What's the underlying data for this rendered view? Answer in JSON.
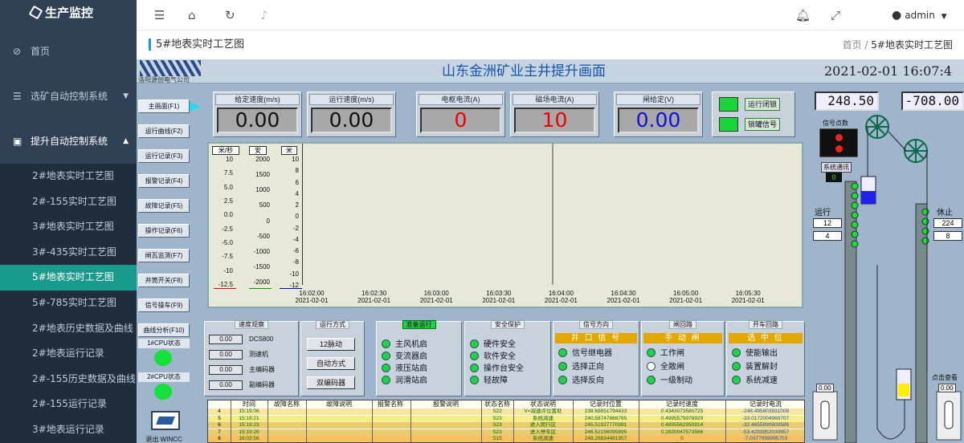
{
  "app": {
    "title": "生产监控"
  },
  "sidebar": {
    "items": [
      {
        "label": "首页"
      },
      {
        "label": "选矿自动控制系统"
      },
      {
        "label": "提升自动控制系统"
      }
    ],
    "subitems": [
      {
        "label": "2#地表实时工艺图"
      },
      {
        "label": "2#-155实时工艺图"
      },
      {
        "label": "3#地表实时工艺图"
      },
      {
        "label": "3#-435实时工艺图"
      },
      {
        "label": "5#地表实时工艺图"
      },
      {
        "label": "5#-785实时工艺图"
      },
      {
        "label": "2#地表历史数据及曲线"
      },
      {
        "label": "2#地表运行记录"
      },
      {
        "label": "2#-155历史数据及曲线"
      },
      {
        "label": "2#-155运行记录"
      },
      {
        "label": "3#地表运行记录"
      }
    ]
  },
  "topbar": {
    "user": "admin"
  },
  "page": {
    "title": "5#地表实时工艺图",
    "breadcrumb_home": "首页",
    "breadcrumb_sep": "/",
    "breadcrumb_current": "5#地表实时工艺图"
  },
  "scada": {
    "company": "洛阳源创电气公司",
    "title": "山东金洲矿业主井提升画面",
    "datetime": "2021-02-01  16:07:4",
    "nav_buttons": [
      {
        "label": "主画面(F1)"
      },
      {
        "label": "运行曲线(F2)"
      },
      {
        "label": "运行记录(F3)"
      },
      {
        "label": "报警记录(F4)"
      },
      {
        "label": "故障记录(F5)"
      },
      {
        "label": "操作记录(F6)"
      },
      {
        "label": "闸瓦监测(F7)"
      },
      {
        "label": "井筒开关(F8)"
      },
      {
        "label": "信号操车(F9)"
      },
      {
        "label": "曲线分析(F10)"
      }
    ],
    "cpu1": "1#CPU状态",
    "cpu2": "2#CPU状态",
    "exit_label": "退出 WINCC",
    "meters": [
      {
        "label": "给定速度(m/s)",
        "value": "0.00",
        "color": "#111111"
      },
      {
        "label": "运行速度(m/s)",
        "value": "0.00",
        "color": "#111111"
      },
      {
        "label": "电枢电流(A)",
        "value": "0",
        "color": "#ee0000"
      },
      {
        "label": "磁场电流(A)",
        "value": "10",
        "color": "#ee0000"
      },
      {
        "label": "闸给定(V)",
        "value": "0.00",
        "color": "#1010dd"
      }
    ],
    "indicators": [
      {
        "label": "运行闭锁"
      },
      {
        "label": "锁罐信号"
      }
    ],
    "chart_data": {
      "type": "line",
      "units": [
        "米/秒",
        "安",
        "米"
      ],
      "y1_ticks": [
        "10",
        "7.5",
        "5.0",
        "2.5",
        "0.0",
        "-2.5",
        "-5.0",
        "-7.5",
        "-10",
        "-12.5"
      ],
      "y2_ticks": [
        "2000",
        "1500",
        "1000",
        "500",
        "0",
        "-500",
        "-1000",
        "-1500",
        "-2000"
      ],
      "y3_ticks": [
        "10",
        "8",
        "6",
        "4",
        "2",
        "0",
        "-2",
        "-4",
        "-6",
        "-8",
        "-10",
        "-12"
      ],
      "x_ticks": [
        {
          "time": "16:02:00",
          "date": "2021-02-01"
        },
        {
          "time": "16:02:30",
          "date": "2021-02-01"
        },
        {
          "time": "16:03:00",
          "date": "2021-02-01"
        },
        {
          "time": "16:03:30",
          "date": "2021-02-01"
        },
        {
          "time": "16:04:00",
          "date": "2021-02-01"
        },
        {
          "time": "16:04:30",
          "date": "2021-02-01"
        },
        {
          "time": "16:05:00",
          "date": "2021-02-01"
        },
        {
          "time": "16:05:30",
          "date": "2021-02-01"
        }
      ]
    },
    "speed_obs": {
      "title": "速度观察",
      "rows": [
        {
          "value": "0.00",
          "label": "DCS800"
        },
        {
          "value": "0.00",
          "label": "测速机"
        },
        {
          "value": "0.00",
          "label": "主编码器"
        },
        {
          "value": "0.00",
          "label": "副编码器"
        }
      ]
    },
    "run_mode": {
      "title": "运行方式",
      "buttons": [
        {
          "label": "12脉动"
        },
        {
          "label": "自动方式"
        },
        {
          "label": "双编码器"
        }
      ]
    },
    "prep": {
      "title": "准备运行",
      "rows": [
        {
          "label": "主风机启"
        },
        {
          "label": "变流器启"
        },
        {
          "label": "液压站启"
        },
        {
          "label": "润滑站启"
        }
      ]
    },
    "safety": {
      "title": "安全保护",
      "rows": [
        {
          "label": "硬件安全"
        },
        {
          "label": "软件安全"
        },
        {
          "label": "操作台安全"
        },
        {
          "label": "轻故障"
        }
      ]
    },
    "signal_dir": {
      "title": "信号方向",
      "bar": "井 口 信 号",
      "rows": [
        {
          "label": "信号继电器"
        },
        {
          "label": "选择正向"
        },
        {
          "label": "选择反向"
        }
      ]
    },
    "brake": {
      "title": "闸回路",
      "bar": "手 动 闸",
      "rows": [
        {
          "label": "工作闸"
        },
        {
          "label": "全敞闸"
        },
        {
          "label": "一级制动"
        }
      ]
    },
    "car_loop": {
      "title": "开车回路",
      "bar": "选 中 位",
      "rows": [
        {
          "label": "使能输出"
        },
        {
          "label": "装置解封"
        },
        {
          "label": "系统减速"
        }
      ]
    },
    "table": {
      "headers": [
        "时间",
        "故障名称",
        "故障说明",
        "报警名称",
        "报警说明",
        "状态名称",
        "状态说明",
        "记录时位置",
        "记录时速度",
        "记录时电流"
      ],
      "rows": [
        {
          "n": "4",
          "time": "15:19:06",
          "state": "S22",
          "desc": "V=减速点位置处",
          "pos": "238.69851794433",
          "speed": "0.4343073580725",
          "current": "-248.495803931008"
        },
        {
          "n": "5",
          "time": "15:19:21",
          "state": "S23",
          "desc": "系统减速",
          "pos": "240.58747868765",
          "speed": "0.4995579976929",
          "current": "-33.0172004969707"
        },
        {
          "n": "6",
          "time": "15:19:23",
          "state": "S23",
          "desc": "进入爬行区",
          "pos": "245.51927770991",
          "speed": "0.4895562950914",
          "current": "-32.4655990600586"
        },
        {
          "n": "7",
          "time": "15:19:26",
          "state": "S23",
          "desc": "进入停车区",
          "pos": "246.52156095895",
          "speed": "0.2820047573566",
          "current": "-53.4293952030957"
        },
        {
          "n": "8",
          "time": "16:03:56",
          "state": "S15",
          "desc": "系统减速",
          "pos": "248.26834481957",
          "speed": "0",
          "current": "-7.0377999995703"
        }
      ]
    },
    "right": {
      "pos_left": "248.50",
      "pos_right": "-708.00",
      "signal_label": "信号点数",
      "comm_label": "系统通讯",
      "comm_value": "0",
      "run_label": "运行",
      "run_a": "12",
      "run_b": "4",
      "stop_label": "休止",
      "stop_a": "224",
      "stop_b": "8",
      "bottom_left": "0.00",
      "bottom_right": "0.00",
      "click_label": "点击查看"
    }
  }
}
